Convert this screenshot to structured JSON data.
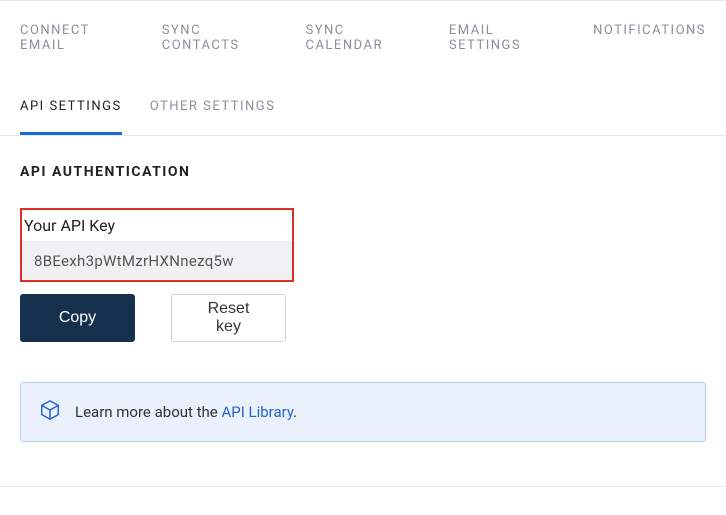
{
  "topNav": {
    "items": [
      {
        "label": "CONNECT  EMAIL"
      },
      {
        "label": "SYNC  CONTACTS"
      },
      {
        "label": "SYNC  CALENDAR"
      },
      {
        "label": "EMAIL  SETTINGS"
      },
      {
        "label": "NOTIFICATIONS"
      }
    ]
  },
  "subNav": {
    "items": [
      {
        "label": "API  SETTINGS",
        "active": true
      },
      {
        "label": "OTHER  SETTINGS",
        "active": false
      }
    ]
  },
  "section": {
    "title": "API  AUTHENTICATION"
  },
  "apiKey": {
    "label": "Your API Key",
    "value": "8BEexh3pWtMzrHXNnezq5w"
  },
  "buttons": {
    "copy": "Copy",
    "reset": "Reset key"
  },
  "info": {
    "prefix": "Learn more about the ",
    "linkText": "API Library",
    "suffix": "."
  }
}
